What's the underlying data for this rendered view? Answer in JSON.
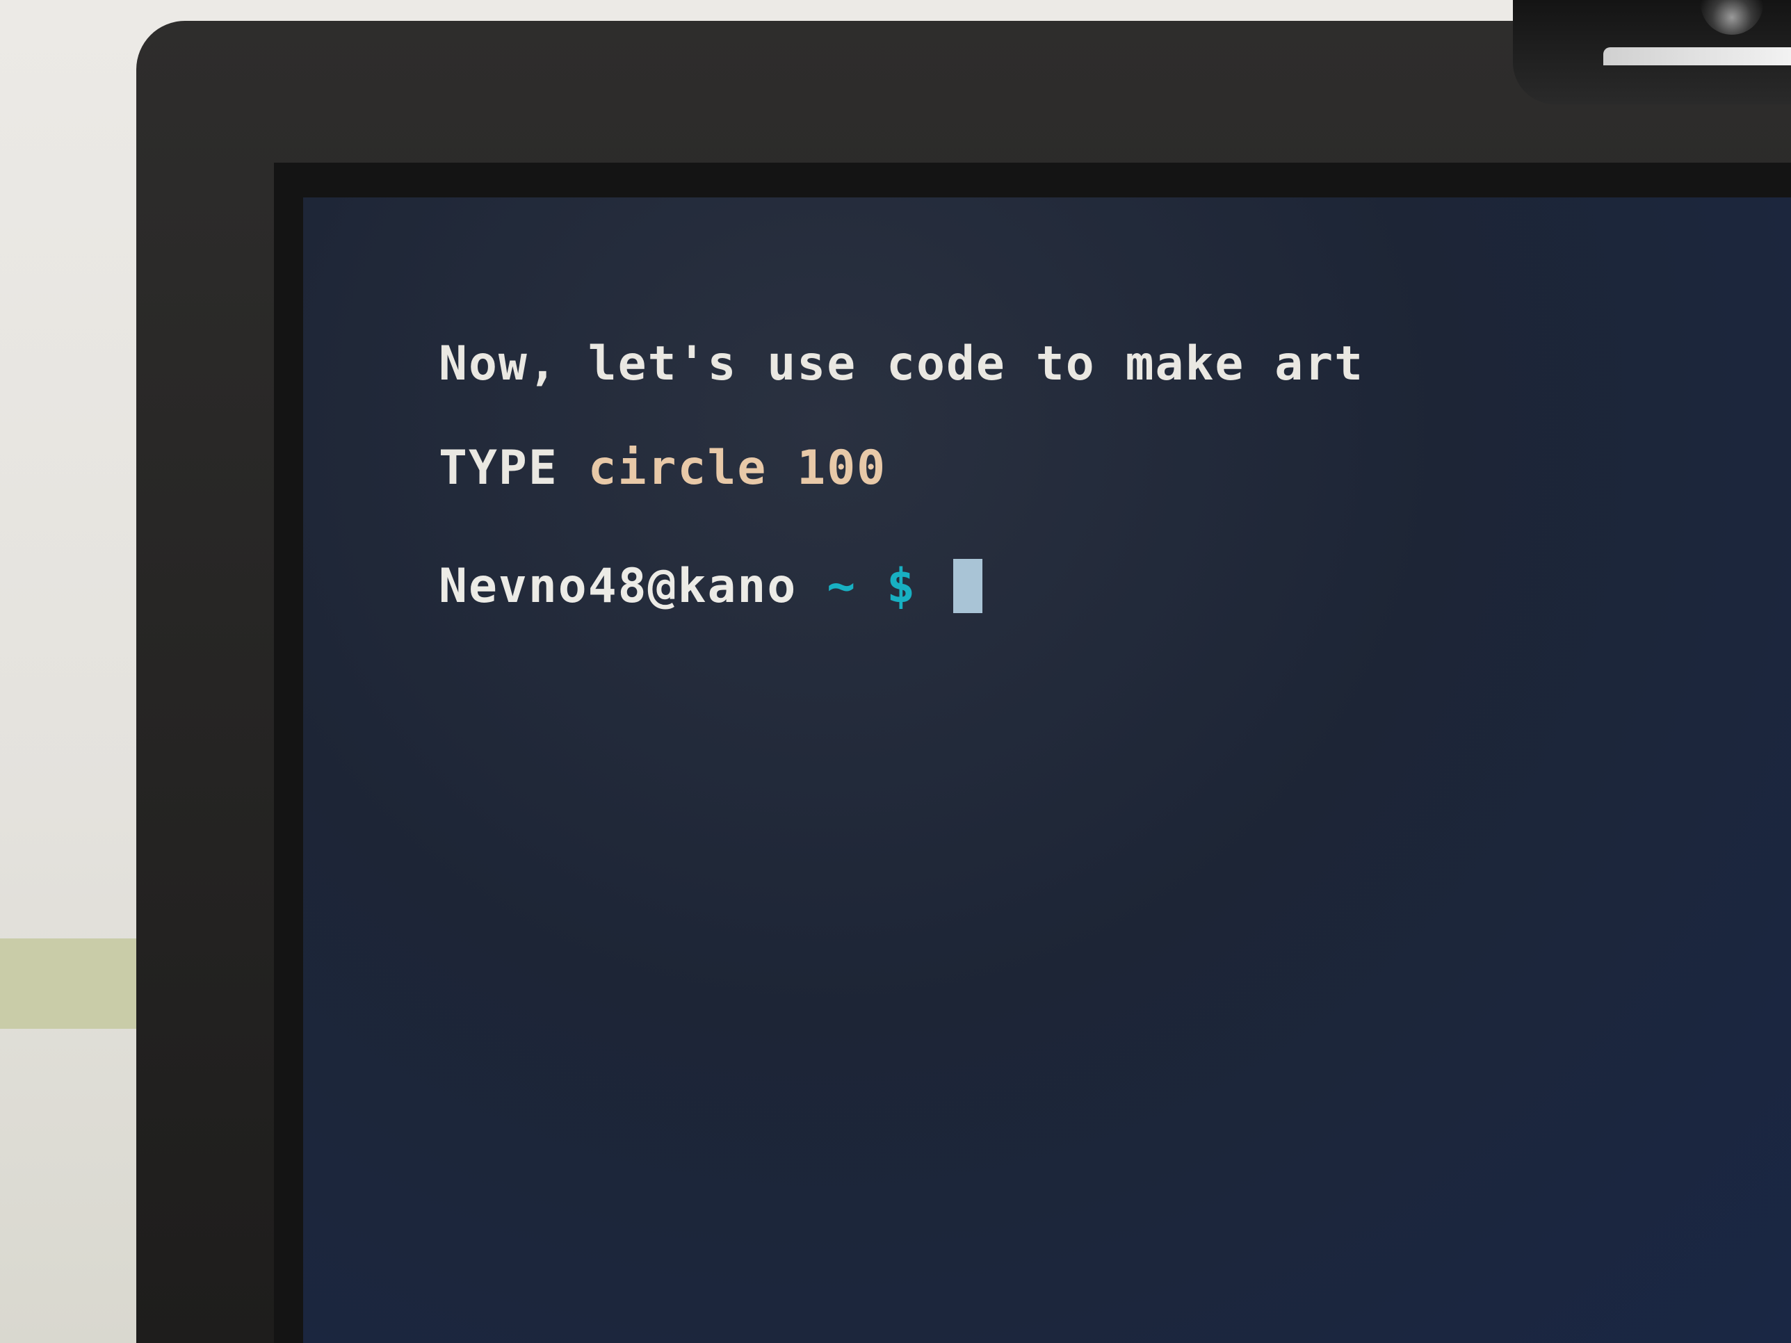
{
  "terminal": {
    "intro_line": "Now, let's use code to make art",
    "instruction": {
      "label": "TYPE",
      "command": "circle 100"
    },
    "prompt": {
      "user_host": "Nevno48@kano",
      "path": "~",
      "symbol": "$"
    }
  },
  "colors": {
    "screen_background": "#1d2536",
    "text": "#eae8e2",
    "command_text": "#e8c9a8",
    "prompt_accent": "#18b0c2",
    "cursor": "#a9c4d6"
  }
}
